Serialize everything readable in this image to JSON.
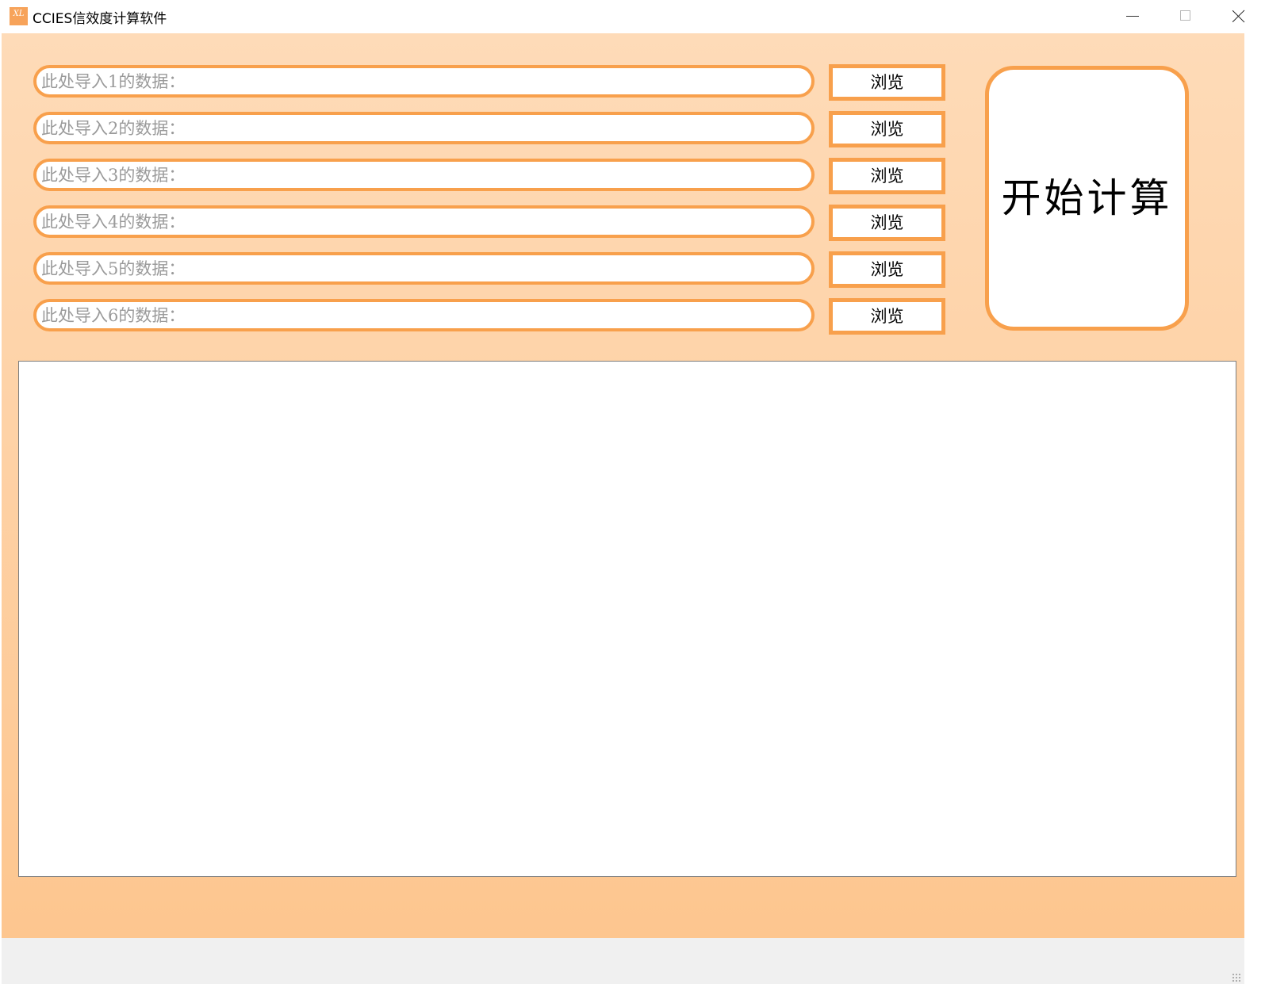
{
  "window": {
    "title": "CCIES信效度计算软件",
    "icon_text": "XL",
    "controls": [
      "minimize-icon",
      "maximize-icon",
      "close-icon"
    ]
  },
  "inputs": [
    {
      "placeholder": "此处导入1的数据：",
      "value": "",
      "browse_label": "浏览"
    },
    {
      "placeholder": "此处导入2的数据：",
      "value": "",
      "browse_label": "浏览"
    },
    {
      "placeholder": "此处导入3的数据：",
      "value": "",
      "browse_label": "浏览"
    },
    {
      "placeholder": "此处导入4的数据：",
      "value": "",
      "browse_label": "浏览"
    },
    {
      "placeholder": "此处导入5的数据：",
      "value": "",
      "browse_label": "浏览"
    },
    {
      "placeholder": "此处导入6的数据：",
      "value": "",
      "browse_label": "浏览"
    }
  ],
  "start_button": {
    "label": "开始计算"
  },
  "output": {
    "text": ""
  },
  "colors": {
    "accent": "#f8a04c",
    "background_top": "#fedbb8",
    "background_bottom": "#fdc68f",
    "placeholder_text": "#9a9a9a"
  }
}
